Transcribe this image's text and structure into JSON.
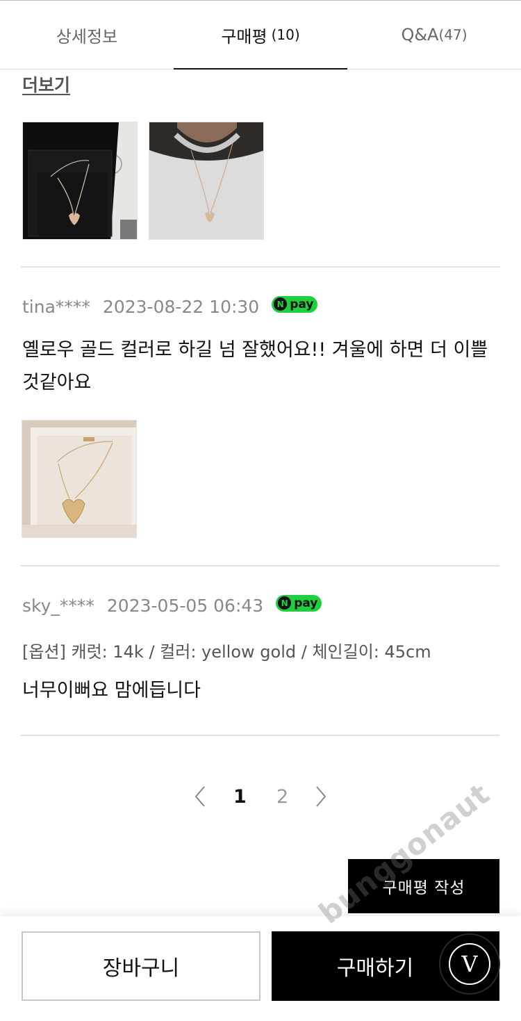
{
  "tabs": [
    {
      "label": "상세정보",
      "count": ""
    },
    {
      "label": "구매평",
      "count": "(10)"
    },
    {
      "label": "Q&A",
      "count": "(47)"
    }
  ],
  "active_tab": 1,
  "more_link": "더보기",
  "reviews": [
    {
      "author": "tina****",
      "date": "2023-08-22 10:30",
      "badge": "pay",
      "badge_icon": "N",
      "text": "옐로우 골드 컬러로 하길 넘 잘했어요!! 겨울에 하면 더 이쁠것같아요"
    },
    {
      "author": "sky_****",
      "date": "2023-05-05 06:43",
      "badge": "pay",
      "badge_icon": "N",
      "option": "[옵션] 캐럿: 14k / 컬러: yellow gold / 체인길이: 45cm",
      "text": "너무이뻐요 맘에듭니다"
    }
  ],
  "pagination": {
    "pages": [
      "1",
      "2"
    ],
    "current": "1"
  },
  "write_review_label": "구매평 작성",
  "bottom_bar": {
    "cart_label": "장바구니",
    "buy_label": "구매하기"
  },
  "badge_letter": "V",
  "watermark": "bunggonaut",
  "colors": {
    "npay_green": "#1fcf3d",
    "accent_black": "#000000",
    "divider": "#e3e3e3"
  },
  "icons": [
    "chevron-left-icon",
    "chevron-right-icon",
    "npay-icon",
    "v-logo-icon"
  ]
}
